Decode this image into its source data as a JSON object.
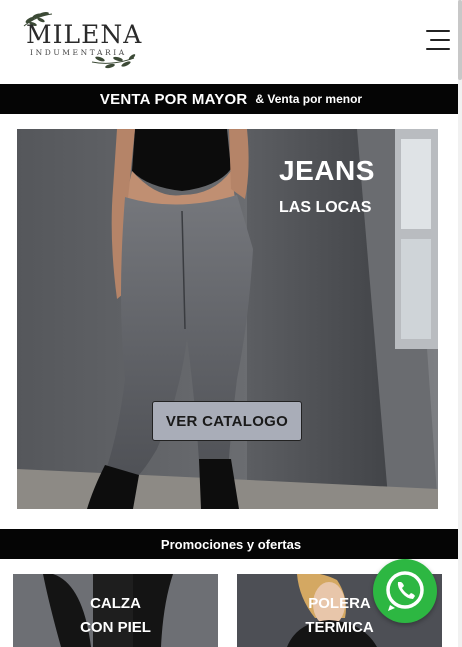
{
  "header": {
    "logo_name": "MILENA",
    "logo_sub": "INDUMENTARIA",
    "menu_icon": "hamburger-menu-icon"
  },
  "topbar": {
    "strong": "VENTA POR MAYOR",
    "light": "& Venta por menor"
  },
  "hero": {
    "title": "JEANS",
    "subtitle": "LAS LOCAS",
    "cta": "VER CATALOGO"
  },
  "promo": {
    "label": "Promociones y ofertas",
    "cards": [
      {
        "line1": "CALZA",
        "line2": "CON PIEL"
      },
      {
        "line1": "POLERA",
        "line2": "TERMICA"
      }
    ]
  },
  "whatsapp": {
    "icon": "whatsapp-icon",
    "color": "#2db742"
  },
  "colors": {
    "bar_bg": "#050505",
    "cta_bg": "#a9adb8"
  }
}
